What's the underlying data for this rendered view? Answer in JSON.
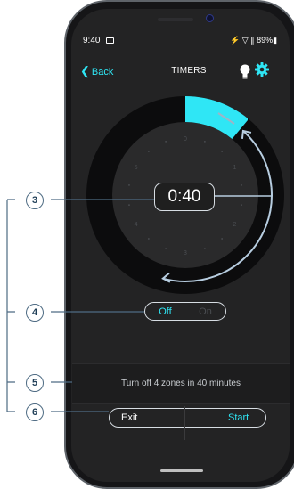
{
  "status_bar": {
    "time": "9:40",
    "indicators": "⚡ ▽ ∥ 89%▮"
  },
  "header": {
    "back_label": "Back",
    "title": "TIMERS",
    "bulb_icon": "light-bulb-icon",
    "settings_icon": "gear-icon"
  },
  "dial": {
    "ticks": [
      "0",
      "1",
      "2",
      "3",
      "4",
      "5"
    ],
    "elapsed_fraction": 0.1
  },
  "timer": {
    "value": "0:40"
  },
  "toggle": {
    "off_label": "Off",
    "on_label": "On",
    "selected": "Off"
  },
  "info": {
    "message": "Turn off 4 zones in 40 minutes"
  },
  "actions": {
    "exit_label": "Exit",
    "start_label": "Start"
  },
  "callouts": [
    "3",
    "4",
    "5",
    "6"
  ],
  "colors": {
    "accent": "#2fe6f5",
    "background": "#232324",
    "callout": "#4e6b83"
  }
}
